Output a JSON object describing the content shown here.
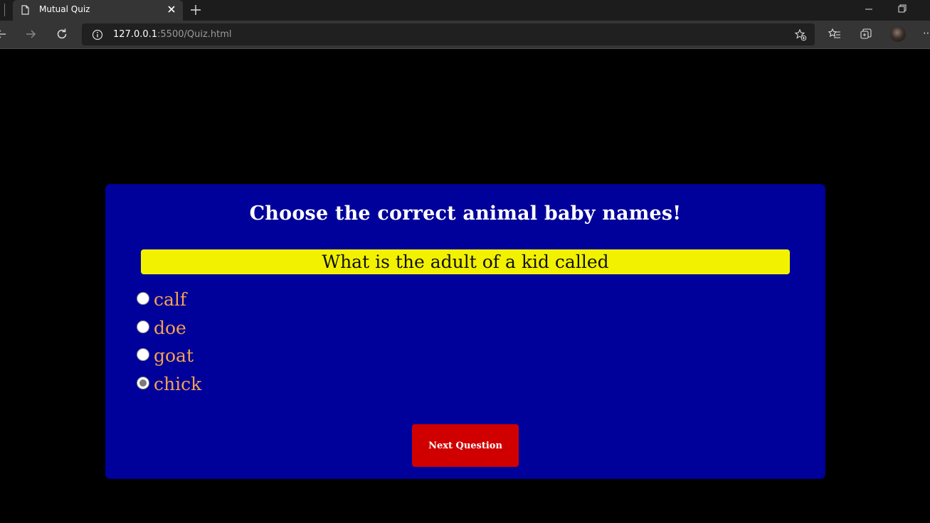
{
  "browser": {
    "tab_title": "Mutual Quiz",
    "url_host": "127.0.0.1",
    "url_path": ":5500/Quiz.html"
  },
  "quiz": {
    "heading": "Choose the correct animal baby names!",
    "question": "What is the adult of a kid called",
    "options": [
      {
        "label": "calf",
        "selected": false
      },
      {
        "label": "doe",
        "selected": false
      },
      {
        "label": "goat",
        "selected": false
      },
      {
        "label": "chick",
        "selected": true
      }
    ],
    "next_button_label": "Next Question"
  },
  "colors": {
    "card_background": "#00009a",
    "question_background": "#f2f200",
    "option_text": "#f4a24e",
    "next_button": "#d00000"
  }
}
